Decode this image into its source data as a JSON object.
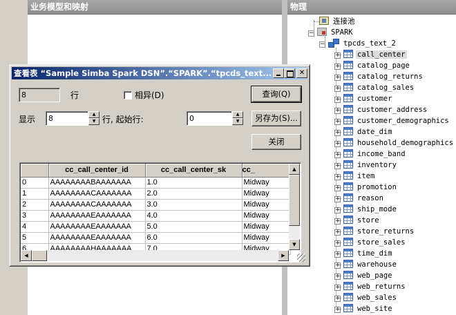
{
  "panes": {
    "business_header": "业务模型和映射",
    "physical_header": "物理"
  },
  "tree": {
    "connection_pool": "连接池",
    "database": "SPARK",
    "schema": "tpcds_text_2",
    "tables": [
      "call_center",
      "catalog_page",
      "catalog_returns",
      "catalog_sales",
      "customer",
      "customer_address",
      "customer_demographics",
      "date_dim",
      "household_demographics",
      "income_band",
      "inventory",
      "item",
      "promotion",
      "reason",
      "ship_mode",
      "store",
      "store_returns",
      "store_sales",
      "time_dim",
      "warehouse",
      "web_page",
      "web_returns",
      "web_sales",
      "web_site"
    ],
    "selected": "call_center"
  },
  "dialog": {
    "title": "查看表 “Sample Simba Spark DSN”.“SPARK”.“tpcds_text...",
    "row_count_value": "8",
    "rows_label": "行",
    "distinct_label": "相异(D)",
    "show_label": "显示",
    "show_value": "8",
    "start_row_label": "行, 起始行:",
    "start_row_value": "0",
    "query_button": "查询(Q)",
    "save_as_button": "另存为(S)...",
    "close_button": "关闭",
    "grid": {
      "columns": [
        "",
        "cc_call_center_id",
        "cc_call_center_sk",
        "cc_"
      ],
      "rows": [
        [
          "0",
          "AAAAAAAABAAAAAAA",
          "1.0",
          "Midway"
        ],
        [
          "1",
          "AAAAAAAACAAAAAAA",
          "2.0",
          "Midway"
        ],
        [
          "2",
          "AAAAAAAACAAAAAAA",
          "3.0",
          "Midway"
        ],
        [
          "3",
          "AAAAAAAAEAAAAAAA",
          "4.0",
          "Midway"
        ],
        [
          "4",
          "AAAAAAAAEAAAAAAA",
          "5.0",
          "Midway"
        ],
        [
          "5",
          "AAAAAAAAEAAAAAAA",
          "6.0",
          "Midway"
        ],
        [
          "6",
          "AAAAAAAAHAAAAAAA",
          "7.0",
          "Midway"
        ]
      ]
    }
  }
}
